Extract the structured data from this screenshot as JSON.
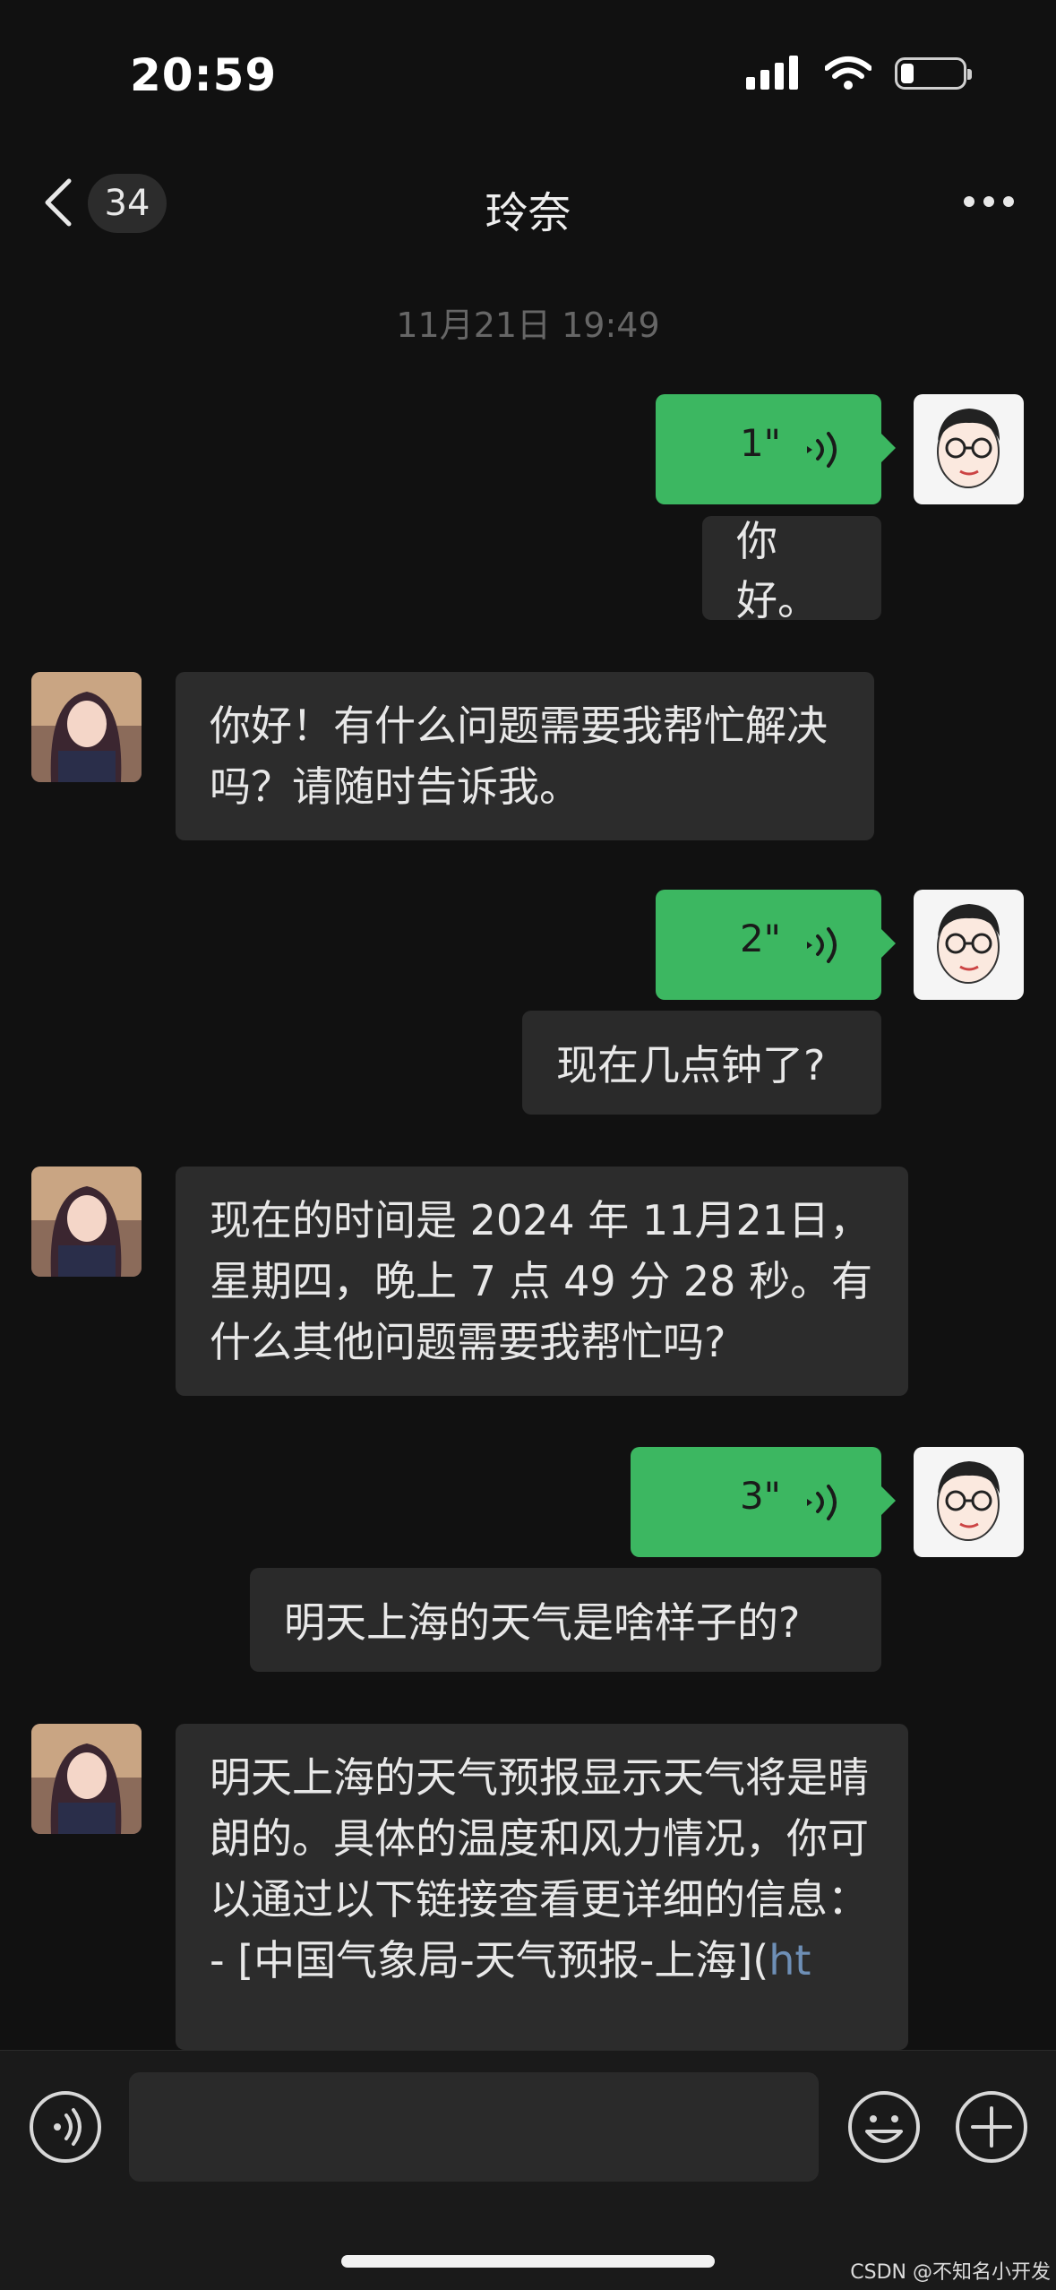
{
  "status_bar": {
    "time": "20:59"
  },
  "nav": {
    "unread_count": "34",
    "title": "玲奈"
  },
  "timestamp": "11月21日 19:49",
  "messages": [
    {
      "sender": "me",
      "type": "voice",
      "duration": "1\"",
      "transcript": "你好。"
    },
    {
      "sender": "bot",
      "type": "text",
      "text": "你好！有什么问题需要我帮忙解决吗？请随时告诉我。"
    },
    {
      "sender": "me",
      "type": "voice",
      "duration": "2\"",
      "transcript": "现在几点钟了?"
    },
    {
      "sender": "bot",
      "type": "text",
      "text": "现在的时间是 2024 年 11月21日，星期四，晚上 7 点 49 分 28 秒。有什么其他问题需要我帮忙吗?"
    },
    {
      "sender": "me",
      "type": "voice",
      "duration": "3\"",
      "transcript": "明天上海的天气是啥样子的?"
    },
    {
      "sender": "bot",
      "type": "text",
      "text": "明天上海的天气预报显示天气将是晴朗的。具体的温度和风力情况，你可以通过以下链接查看更详细的信息：",
      "list_item": "- [中国气象局-天气预报-上海](",
      "link_fragment": "ht"
    }
  ],
  "input": {
    "value": ""
  },
  "watermark": "CSDN @不知名小开发",
  "colors": {
    "background": "#111111",
    "voice_bubble": "#3cb761",
    "text_bubble": "#2c2c2c",
    "link": "#6e8fb6"
  }
}
